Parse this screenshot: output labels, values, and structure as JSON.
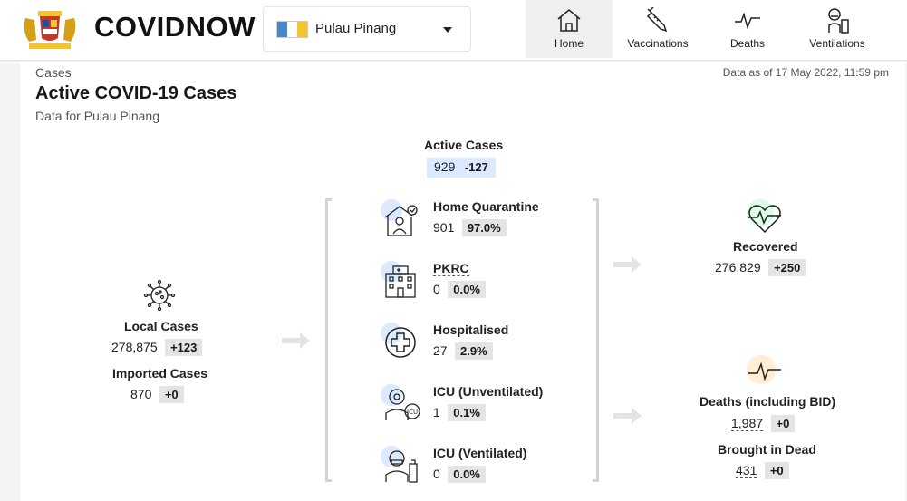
{
  "header": {
    "brand": "COVIDNOW",
    "state": "Pulau Pinang",
    "nav": [
      {
        "label": "Home",
        "icon": "home-icon",
        "active": true
      },
      {
        "label": "Vaccinations",
        "icon": "syringe-icon",
        "active": false
      },
      {
        "label": "Deaths",
        "icon": "pulse-icon",
        "active": false
      },
      {
        "label": "Ventilations",
        "icon": "ventilator-icon",
        "active": false
      }
    ]
  },
  "card": {
    "kicker": "Cases",
    "title": "Active COVID-19 Cases",
    "subtitle": "Data for Pulau Pinang",
    "as_of": "Data as of 17 May 2022, 11:59 pm"
  },
  "active": {
    "label": "Active Cases",
    "value": "929",
    "change": "-127"
  },
  "local": {
    "label": "Local Cases",
    "value": "278,875",
    "change": "+123"
  },
  "imported": {
    "label": "Imported Cases",
    "value": "870",
    "change": "+0"
  },
  "breakdown": [
    {
      "label": "Home Quarantine",
      "value": "901",
      "pct": "97.0%",
      "icon": "home-quarantine-icon"
    },
    {
      "label": "PKRC",
      "value": "0",
      "pct": "0.0%",
      "icon": "building-icon"
    },
    {
      "label": "Hospitalised",
      "value": "27",
      "pct": "2.9%",
      "icon": "medical-cross-icon"
    },
    {
      "label": "ICU (Unventilated)",
      "value": "1",
      "pct": "0.1%",
      "icon": "icu-icon"
    },
    {
      "label": "ICU (Ventilated)",
      "value": "0",
      "pct": "0.0%",
      "icon": "ventilated-icon"
    }
  ],
  "recovered": {
    "label": "Recovered",
    "value": "276,829",
    "change": "+250"
  },
  "deaths": {
    "label": "Deaths (including BID)",
    "value": "1,987",
    "change": "+0"
  },
  "bid": {
    "label": "Brought in Dead",
    "value": "431",
    "change": "+0"
  },
  "colors": {
    "accent_blue": "#dbeafe",
    "chip_gray": "#e4e4e7",
    "recovered_bg": "#dcfce7",
    "deaths_bg": "#ffedd5"
  }
}
